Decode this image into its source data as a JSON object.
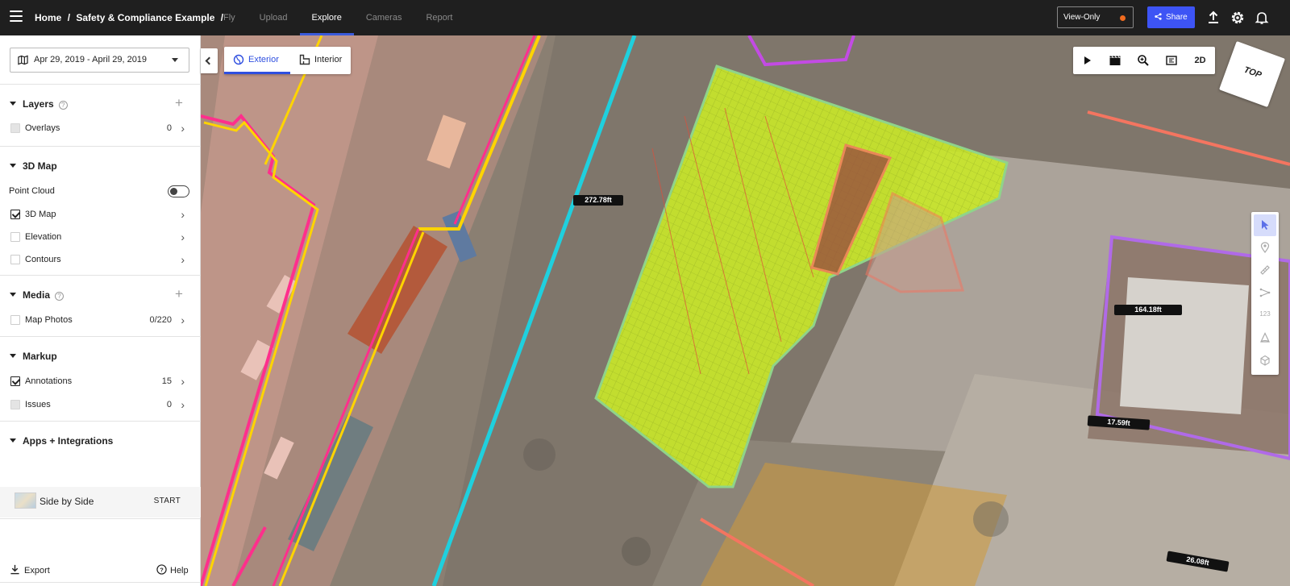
{
  "topbar": {
    "breadcrumb": [
      "Home",
      "/",
      "Safety & Compliance Example",
      "/"
    ],
    "tabs": [
      {
        "label": "Fly",
        "active": false
      },
      {
        "label": "Upload",
        "active": false
      },
      {
        "label": "Explore",
        "active": true
      },
      {
        "label": "Cameras",
        "active": false
      },
      {
        "label": "Report",
        "active": false
      }
    ],
    "view_only": "View-Only",
    "share": "Share",
    "colors": {
      "accent": "#3d54f5",
      "status_dot": "#f06b1f",
      "bar": "#1f1f1f"
    }
  },
  "sidebar": {
    "date_range": "Apr 29, 2019 - April 29, 2019",
    "layers": {
      "title": "Layers",
      "items": [
        {
          "label": "Overlays",
          "count": "0"
        }
      ]
    },
    "map3d": {
      "title": "3D Map",
      "point_cloud": "Point Cloud",
      "items": [
        {
          "label": "3D Map"
        },
        {
          "label": "Elevation"
        },
        {
          "label": "Contours"
        }
      ]
    },
    "media": {
      "title": "Media",
      "items": [
        {
          "label": "Map Photos",
          "count": "0/220"
        }
      ]
    },
    "markup": {
      "title": "Markup",
      "items": [
        {
          "label": "Annotations",
          "count": "15"
        },
        {
          "label": "Issues",
          "count": "0"
        }
      ]
    },
    "apps": {
      "title": "Apps + Integrations",
      "side_by_side": "Side by Side",
      "start": "START"
    },
    "footer": {
      "export": "Export",
      "help": "Help"
    }
  },
  "map": {
    "view_tabs": [
      {
        "label": "Exterior",
        "active": true
      },
      {
        "label": "Interior",
        "active": false
      }
    ],
    "view_mode": "2D",
    "compass": "TOP",
    "tool_number_label": "123",
    "measurements": [
      "272.78ft",
      "164.18ft",
      "17.59ft",
      "26.08ft"
    ]
  }
}
